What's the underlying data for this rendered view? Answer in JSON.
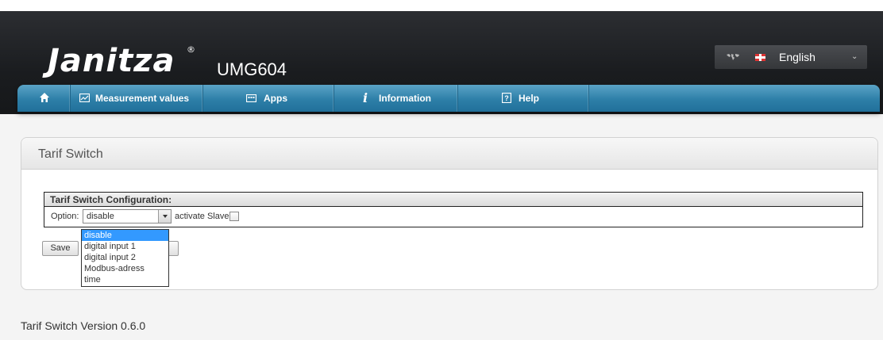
{
  "header": {
    "logo_text": "Janitza",
    "logo_mark": "®",
    "device_name": "UMG604",
    "language": {
      "label": "English",
      "icons": [
        "world-map-icon",
        "flag-icon",
        "chevron-down-icon"
      ]
    }
  },
  "nav": {
    "home_icon": "home-icon",
    "items": [
      {
        "label": "Measurement values",
        "icon": "chart-icon"
      },
      {
        "label": "Apps",
        "icon": "apps-icon"
      },
      {
        "label": "Information",
        "icon": "info-icon"
      },
      {
        "label": "Help",
        "icon": "help-icon"
      }
    ]
  },
  "panel": {
    "title": "Tarif Switch",
    "config": {
      "heading": "Tarif Switch Configuration:",
      "option_label": "Option:",
      "option_value": "disable",
      "slave_label": "activate Slave:",
      "slave_checked": false
    },
    "dropdown_options": [
      "disable",
      "digital input 1",
      "digital input 2",
      "Modbus-adress",
      "time"
    ],
    "dropdown_selected": "disable",
    "save_label": "Save"
  },
  "footer": {
    "version": "Tarif Switch Version 0.6.0"
  }
}
